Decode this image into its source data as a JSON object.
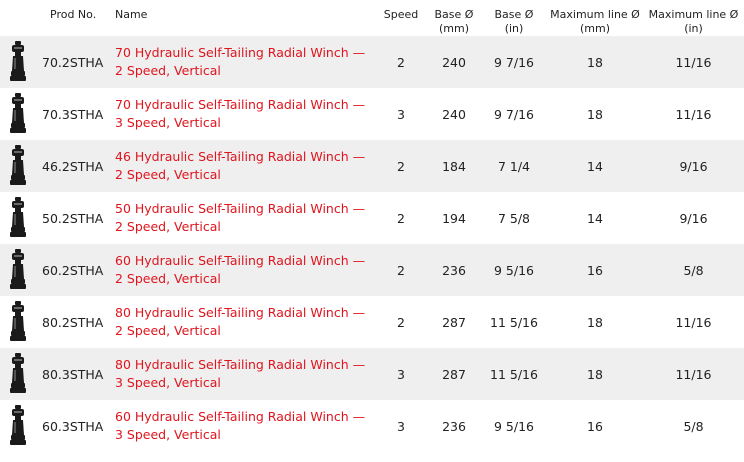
{
  "headers": {
    "image": "",
    "prod_no": "Prod No.",
    "name": "Name",
    "speed": "Speed",
    "base_mm": "Base Ø\n(mm)",
    "base_in": "Base Ø\n(in)",
    "max_line_mm": "Maximum line Ø\n(mm)",
    "max_line_in": "Maximum line Ø\n(in)"
  },
  "rows": [
    {
      "prod_no": "70.2STHA",
      "name": "70 Hydraulic Self-Tailing Radial Winch — 2 Speed, Vertical",
      "speed": "2",
      "base_mm": "240",
      "base_in": "9 7/16",
      "max_line_mm": "18",
      "max_line_in": "11/16",
      "icon": "winch-icon"
    },
    {
      "prod_no": "70.3STHA",
      "name": "70 Hydraulic Self-Tailing Radial Winch — 3 Speed, Vertical",
      "speed": "3",
      "base_mm": "240",
      "base_in": "9 7/16",
      "max_line_mm": "18",
      "max_line_in": "11/16",
      "icon": "winch-icon"
    },
    {
      "prod_no": "46.2STHA",
      "name": "46 Hydraulic Self-Tailing Radial Winch — 2 Speed, Vertical",
      "speed": "2",
      "base_mm": "184",
      "base_in": "7 1/4",
      "max_line_mm": "14",
      "max_line_in": "9/16",
      "icon": "winch-icon"
    },
    {
      "prod_no": "50.2STHA",
      "name": "50 Hydraulic Self-Tailing Radial Winch — 2 Speed, Vertical",
      "speed": "2",
      "base_mm": "194",
      "base_in": "7 5/8",
      "max_line_mm": "14",
      "max_line_in": "9/16",
      "icon": "winch-icon"
    },
    {
      "prod_no": "60.2STHA",
      "name": "60 Hydraulic Self-Tailing Radial Winch — 2 Speed, Vertical",
      "speed": "2",
      "base_mm": "236",
      "base_in": "9 5/16",
      "max_line_mm": "16",
      "max_line_in": "5/8",
      "icon": "winch-icon"
    },
    {
      "prod_no": "80.2STHA",
      "name": "80 Hydraulic Self-Tailing Radial Winch — 2 Speed, Vertical",
      "speed": "2",
      "base_mm": "287",
      "base_in": "11 5/16",
      "max_line_mm": "18",
      "max_line_in": "11/16",
      "icon": "winch-icon"
    },
    {
      "prod_no": "80.3STHA",
      "name": "80 Hydraulic Self-Tailing Radial Winch — 3 Speed, Vertical",
      "speed": "3",
      "base_mm": "287",
      "base_in": "11 5/16",
      "max_line_mm": "18",
      "max_line_in": "11/16",
      "icon": "winch-icon"
    },
    {
      "prod_no": "60.3STHA",
      "name": "60 Hydraulic Self-Tailing Radial Winch — 3 Speed, Vertical",
      "speed": "3",
      "base_mm": "236",
      "base_in": "9 5/16",
      "max_line_mm": "16",
      "max_line_in": "5/8",
      "icon": "winch-icon"
    }
  ],
  "colors": {
    "link": "#e0141e",
    "row_stripe": "#efefef",
    "winch_body": "#1a1a1a"
  }
}
